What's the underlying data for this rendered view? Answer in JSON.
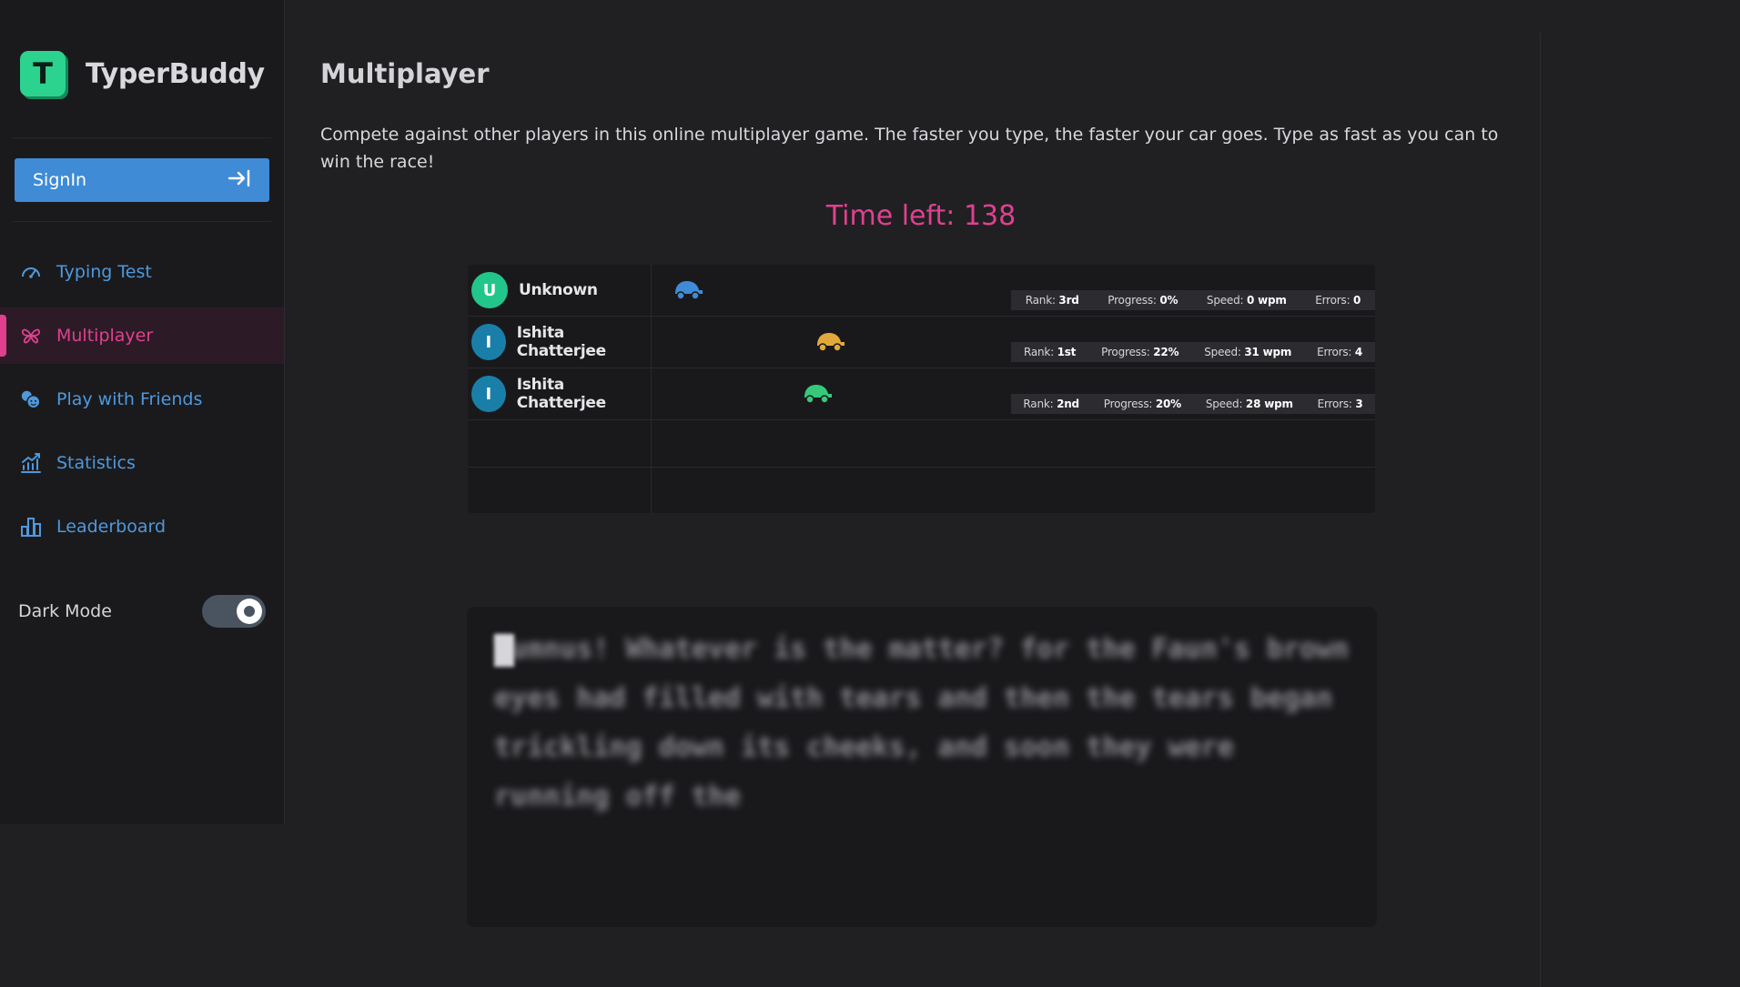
{
  "app": {
    "logo_letter": "T",
    "name": "TyperBuddy",
    "accent_color": "#e0408f",
    "logo_color": "#2bd38f",
    "link_color": "#4f98dc"
  },
  "sidebar": {
    "signin_label": "SignIn",
    "signin_icon": "arrow-to-right-icon",
    "nav": [
      {
        "label": "Typing Test",
        "icon": "speedometer-icon",
        "active": false
      },
      {
        "label": "Multiplayer",
        "icon": "butterfly-icon",
        "active": true
      },
      {
        "label": "Play with Friends",
        "icon": "friends-icon",
        "active": false
      },
      {
        "label": "Statistics",
        "icon": "chart-line-icon",
        "active": false
      },
      {
        "label": "Leaderboard",
        "icon": "bar-chart-icon",
        "active": false
      }
    ],
    "dark_mode_label": "Dark Mode",
    "dark_mode_on": true
  },
  "main": {
    "title": "Multiplayer",
    "description": "Compete against other players in this online multiplayer game. The faster you type, the faster your car goes. Type as fast as you can to win the race!",
    "timer": "Time left: 138"
  },
  "race": {
    "lanes": [
      {
        "initial": "U",
        "name": "Unknown",
        "avatar_color": "#22c68a",
        "car_color": "#3f8bd6",
        "progress": 0,
        "rank_label": "Rank: ",
        "rank": "3rd",
        "progress_label": "Progress: ",
        "progress_text": "0%",
        "speed_label": "Speed: ",
        "speed": "0 wpm",
        "errors_label": "Errors: ",
        "errors": "0"
      },
      {
        "initial": "I",
        "name": "Ishita Chatterjee",
        "avatar_color": "#1a7fa8",
        "car_color": "#e0a93a",
        "progress": 22,
        "rank_label": "Rank: ",
        "rank": "1st",
        "progress_label": "Progress: ",
        "progress_text": "22%",
        "speed_label": "Speed: ",
        "speed": "31 wpm",
        "errors_label": "Errors: ",
        "errors": "4"
      },
      {
        "initial": "I",
        "name": "Ishita Chatterjee",
        "avatar_color": "#1a7fa8",
        "car_color": "#37c97a",
        "progress": 20,
        "rank_label": "Rank: ",
        "rank": "2nd",
        "progress_label": "Progress: ",
        "progress_text": "20%",
        "speed_label": "Speed: ",
        "speed": "28 wpm",
        "errors_label": "Errors: ",
        "errors": "3"
      }
    ],
    "empty_lanes": 2
  },
  "typing": {
    "text": "Tumnus! Whatever is the matter? for the Faun's brown eyes had filled with tears and then the tears began trickling down its cheeks, and soon they were running off the"
  }
}
